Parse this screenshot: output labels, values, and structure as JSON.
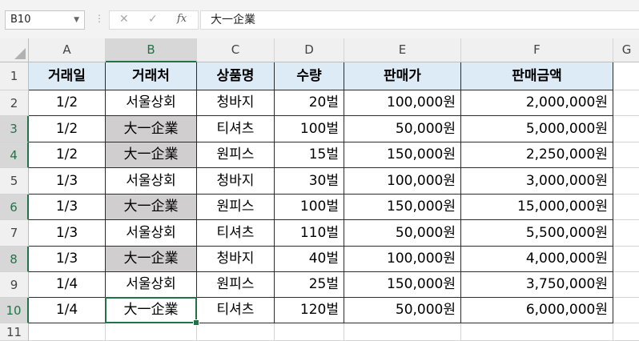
{
  "formula_bar": {
    "name_box": "B10",
    "cancel_glyph": "✕",
    "enter_glyph": "✓",
    "function_glyph": "fx",
    "formula": "大一企業"
  },
  "sheet": {
    "columns": [
      "A",
      "B",
      "C",
      "D",
      "E",
      "F",
      "G"
    ],
    "rows": [
      "1",
      "2",
      "3",
      "4",
      "5",
      "6",
      "7",
      "8",
      "9",
      "10",
      "11"
    ],
    "selected_rows": [
      "3",
      "4",
      "6",
      "8",
      "10"
    ],
    "selected_column": "B",
    "active_cell": "B10",
    "header": [
      "거래일",
      "거래처",
      "상품명",
      "수량",
      "판매가",
      "판매금액"
    ],
    "data": [
      [
        "1/2",
        "서울상회",
        "청바지",
        "20벌",
        "100,000원",
        "2,000,000원"
      ],
      [
        "1/2",
        "大一企業",
        "티셔츠",
        "100벌",
        "50,000원",
        "5,000,000원"
      ],
      [
        "1/2",
        "大一企業",
        "원피스",
        "15벌",
        "150,000원",
        "2,250,000원"
      ],
      [
        "1/3",
        "서울상회",
        "청바지",
        "30벌",
        "100,000원",
        "3,000,000원"
      ],
      [
        "1/3",
        "大一企業",
        "원피스",
        "100벌",
        "150,000원",
        "15,000,000원"
      ],
      [
        "1/3",
        "서울상회",
        "티셔츠",
        "110벌",
        "50,000원",
        "5,500,000원"
      ],
      [
        "1/3",
        "大一企業",
        "청바지",
        "40벌",
        "100,000원",
        "4,000,000원"
      ],
      [
        "1/4",
        "서울상회",
        "원피스",
        "25벌",
        "150,000원",
        "3,750,000원"
      ],
      [
        "1/4",
        "大一企業",
        "티셔츠",
        "120벌",
        "50,000원",
        "6,000,000원"
      ]
    ],
    "highlighted_cells": [
      "B3",
      "B4",
      "B6",
      "B8"
    ],
    "colors": {
      "header_fill": "#ddebf7",
      "highlight_fill": "#d0cece",
      "selection": "#217346"
    }
  }
}
